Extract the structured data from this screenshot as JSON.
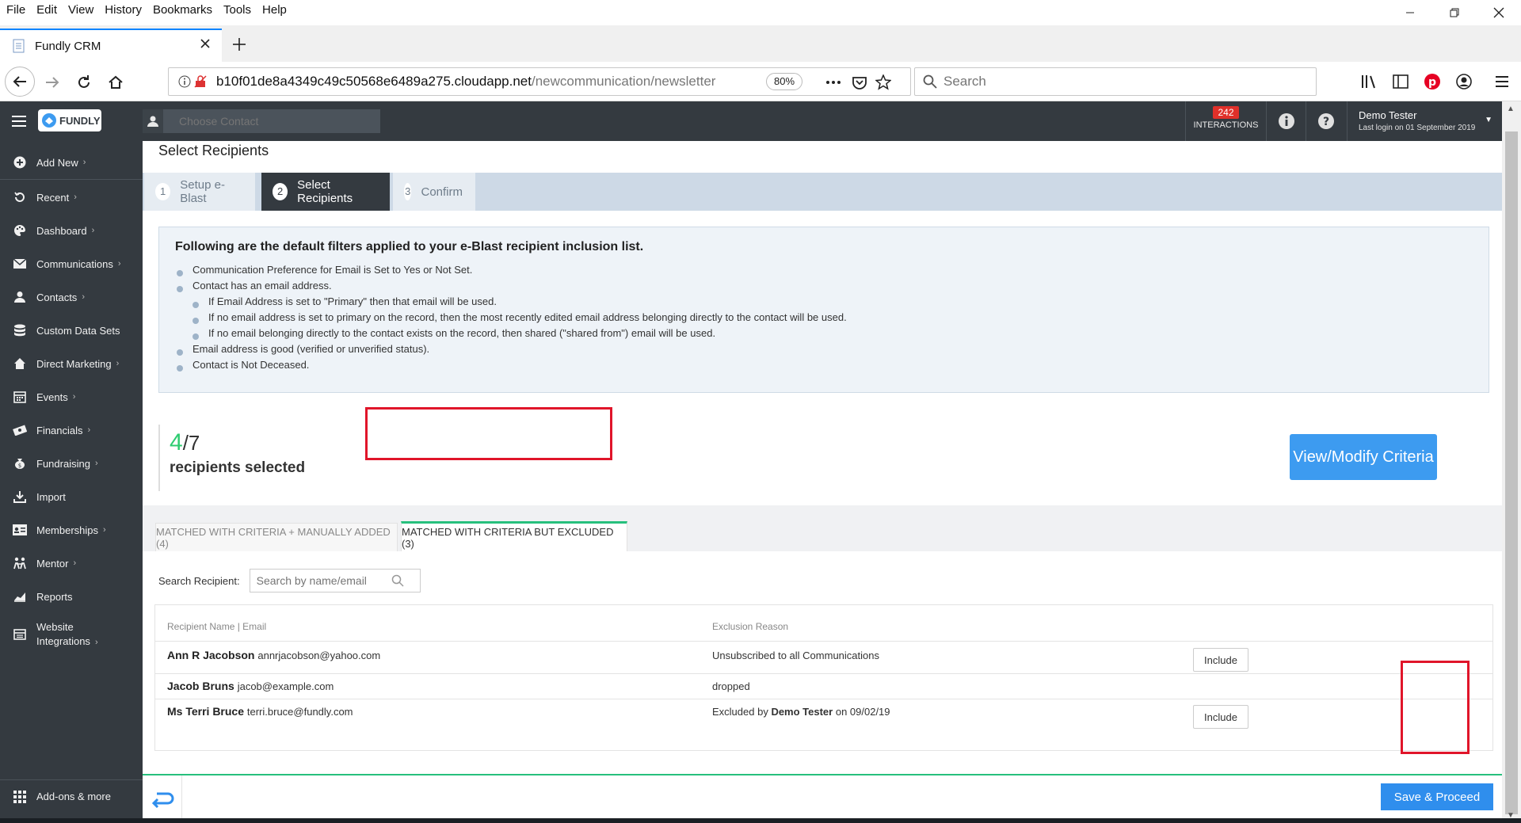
{
  "browser": {
    "menu": [
      "File",
      "Edit",
      "View",
      "History",
      "Bookmarks",
      "Tools",
      "Help"
    ],
    "tab_title": "Fundly CRM",
    "url_main": "b10f01de8a4349c49c50568e6489a275.cloudapp.net",
    "url_path": "/newcommunication/newsletter",
    "zoom": "80%",
    "search_placeholder": "Search"
  },
  "app": {
    "logo_text": "FUNDLY",
    "choose_contact_placeholder": "Choose Contact",
    "interactions_count": "242",
    "interactions_label": "INTERACTIONS",
    "user_name": "Demo Tester",
    "last_login": "Last login on 01 September 2019"
  },
  "sidebar": {
    "items": [
      {
        "label": "Add New",
        "icon": "plus-circle-icon",
        "chevron": true
      },
      {
        "label": "Recent",
        "icon": "history-icon",
        "chevron": true
      },
      {
        "label": "Dashboard",
        "icon": "palette-icon",
        "chevron": true
      },
      {
        "label": "Communications",
        "icon": "envelope-icon",
        "chevron": true
      },
      {
        "label": "Contacts",
        "icon": "user-icon",
        "chevron": true
      },
      {
        "label": "Custom Data Sets",
        "icon": "database-icon",
        "chevron": false
      },
      {
        "label": "Direct Marketing",
        "icon": "home-icon",
        "chevron": true
      },
      {
        "label": "Events",
        "icon": "calendar-icon",
        "chevron": true
      },
      {
        "label": "Financials",
        "icon": "money-icon",
        "chevron": true
      },
      {
        "label": "Fundraising",
        "icon": "moneybag-icon",
        "chevron": true
      },
      {
        "label": "Import",
        "icon": "download-icon",
        "chevron": false
      },
      {
        "label": "Memberships",
        "icon": "id-card-icon",
        "chevron": true
      },
      {
        "label": "Mentor",
        "icon": "mentor-icon",
        "chevron": true
      },
      {
        "label": "Reports",
        "icon": "chart-icon",
        "chevron": false
      },
      {
        "label": "Website",
        "label2": "Integrations",
        "icon": "window-icon",
        "chevron": true
      }
    ],
    "addons": "Add-ons & more"
  },
  "main": {
    "page_title": "Select Recipients",
    "steps": [
      {
        "num": "1",
        "label": "Setup e-Blast"
      },
      {
        "num": "2",
        "label": "Select Recipients"
      },
      {
        "num": "3",
        "label": "Confirm"
      }
    ],
    "filters_title": "Following are the default filters applied to your e-Blast recipient inclusion list.",
    "filters": [
      "Communication Preference for Email is Set to Yes or Not Set.",
      "Contact has an email address.",
      "If Email Address is set to \"Primary\" then that email will be used.",
      "If no email address is set to primary on the record, then the most recently edited email address belonging directly to the contact will be used.",
      "If no email belonging directly to the contact exists on the record, then shared (\"shared from\") email will be used.",
      "Email address is good (verified or unverified status).",
      "Contact is Not Deceased."
    ],
    "selected_count": "4",
    "total_count": "/7",
    "recipients_label": "recipients selected",
    "view_modify_label": "View/Modify Criteria",
    "tabs": [
      {
        "label": "MATCHED WITH CRITERIA + MANUALLY ADDED (4)"
      },
      {
        "label": "MATCHED WITH CRITERIA BUT EXCLUDED (3)"
      }
    ],
    "search_label": "Search Recipient:",
    "search_placeholder": "Search by name/email",
    "table": {
      "col_name": "Recipient Name | Email",
      "col_reason": "Exclusion Reason",
      "rows": [
        {
          "name": "Ann R Jacobson",
          "email": "annrjacobson@yahoo.com",
          "reason": "Unsubscribed to all Communications",
          "action": "Include"
        },
        {
          "name": "Jacob Bruns",
          "email": "jacob@example.com",
          "reason": "dropped",
          "action": ""
        },
        {
          "name": "Ms Terri Bruce",
          "email": "terri.bruce@fundly.com",
          "reason_prefix": "Excluded by ",
          "reason_user": "Demo Tester",
          "reason_suffix": " on 09/02/19",
          "action": "Include"
        }
      ]
    },
    "save_label": "Save & Proceed"
  },
  "colors": {
    "sidebar_bg": "#343a40",
    "accent_green": "#27c07d",
    "primary_blue": "#3d9bf0",
    "highlight_red": "#e0152a",
    "badge_red": "#e0302a"
  }
}
